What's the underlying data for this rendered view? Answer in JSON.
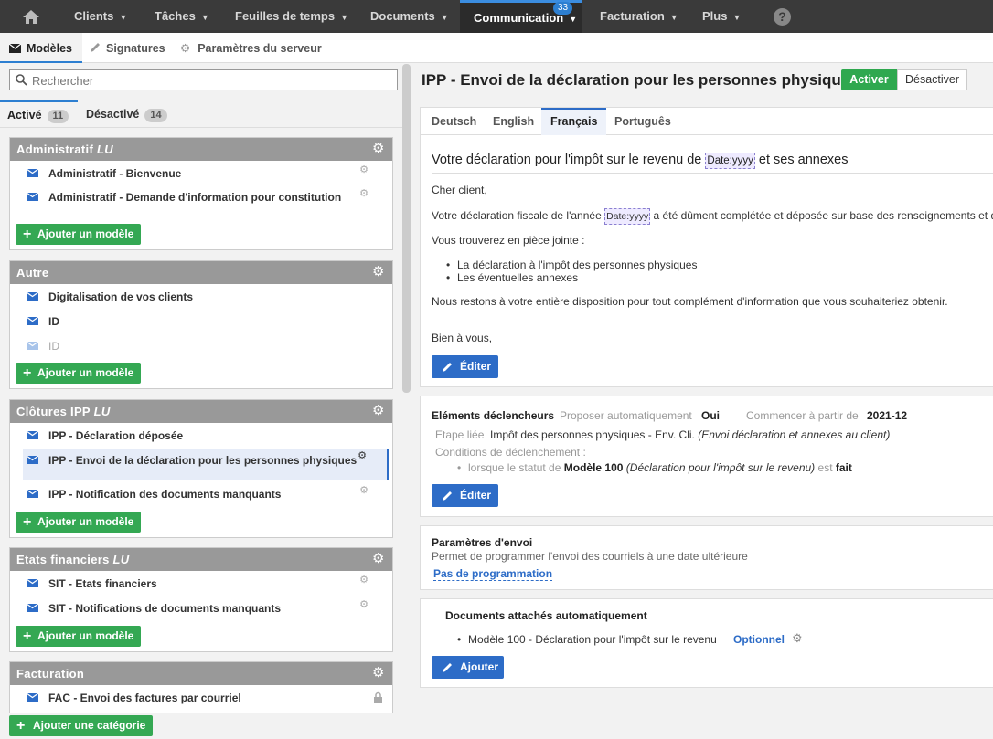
{
  "topnav": {
    "items": [
      {
        "label": "Clients"
      },
      {
        "label": "Tâches"
      },
      {
        "label": "Feuilles de temps"
      },
      {
        "label": "Documents"
      },
      {
        "label": "Communication",
        "badge": "33"
      },
      {
        "label": "Facturation"
      },
      {
        "label": "Plus"
      }
    ],
    "help": "?"
  },
  "subnav": {
    "items": [
      {
        "label": "Modèles"
      },
      {
        "label": "Signatures"
      },
      {
        "label": "Paramètres du serveur"
      }
    ]
  },
  "left": {
    "search_placeholder": "Rechercher",
    "tabs": [
      {
        "label": "Activé",
        "count": "11"
      },
      {
        "label": "Désactivé",
        "count": "14"
      }
    ],
    "categories": [
      {
        "name": "Administratif",
        "tag": "LU",
        "templates": [
          "Administratif - Bienvenue",
          "Administratif - Demande d'information pour constitution"
        ],
        "add": "Ajouter un modèle"
      },
      {
        "name": "Autre",
        "tag": "",
        "templates": [
          "Digitalisation de vos clients",
          "ID",
          "ID"
        ],
        "add": "Ajouter un modèle"
      },
      {
        "name": "Clôtures IPP",
        "tag": "LU",
        "templates": [
          "IPP - Déclaration déposée",
          "IPP - Envoi de la déclaration pour les personnes physiques",
          "IPP - Notification des documents manquants"
        ],
        "add": "Ajouter un modèle"
      },
      {
        "name": "Etats financiers",
        "tag": "LU",
        "templates": [
          "SIT - Etats financiers",
          "SIT - Notifications de documents manquants"
        ],
        "add": "Ajouter un modèle"
      },
      {
        "name": "Facturation",
        "tag": "",
        "templates": [
          "FAC - Envoi des factures par courriel"
        ]
      }
    ],
    "add_category": "Ajouter une catégorie"
  },
  "right": {
    "title": "IPP - Envoi de la déclaration pour les personnes physiques",
    "activate": "Activer",
    "deactivate": "Désactiver",
    "languages": [
      "Deutsch",
      "English",
      "Français",
      "Português"
    ],
    "email": {
      "subject_before": "Votre déclaration pour l'impôt sur le revenu de",
      "subject_tag": "Date:yyyy",
      "subject_after": "et ses annexes",
      "greeting": "Cher client,",
      "line1_before": "Votre déclaration fiscale de l'année",
      "line1_tag": "Date:yyyy",
      "line1_after": "a été dûment complétée et déposée sur base des renseignements et do",
      "line2": "Vous trouverez en pièce jointe :",
      "bullets": [
        "La déclaration à l'impôt des personnes physiques",
        "Les éventuelles annexes"
      ],
      "line3": "Nous restons à votre entière disposition pour tout complément d'information que vous souhaiteriez obtenir.",
      "signoff": "Bien à vous,"
    },
    "edit": "Éditer",
    "triggers": {
      "title": "Eléments déclencheurs",
      "propose_label": "Proposer automatiquement",
      "propose_value": "Oui",
      "start_label": "Commencer à partir de",
      "start_value": "2021-12",
      "linked_label": "Etape liée",
      "linked_value": "Impôt des personnes physiques - Env. Cli.",
      "linked_note": "(Envoi déclaration et annexes au client)",
      "conditions_label": "Conditions de déclenchement :",
      "cond_pre": "lorsque le statut de",
      "cond_model": "Modèle 100",
      "cond_note": "(Déclaration pour l'impôt sur le revenu)",
      "cond_est": "est",
      "cond_state": "fait"
    },
    "send": {
      "title": "Paramètres d'envoi",
      "desc": "Permet de programmer l'envoi des courriels à une date ultérieure",
      "link": "Pas de programmation"
    },
    "attachments": {
      "title": "Documents attachés automatiquement",
      "item": "Modèle 100 - Déclaration pour l'impôt sur le revenu",
      "option": "Optionnel",
      "add": "Ajouter"
    }
  }
}
